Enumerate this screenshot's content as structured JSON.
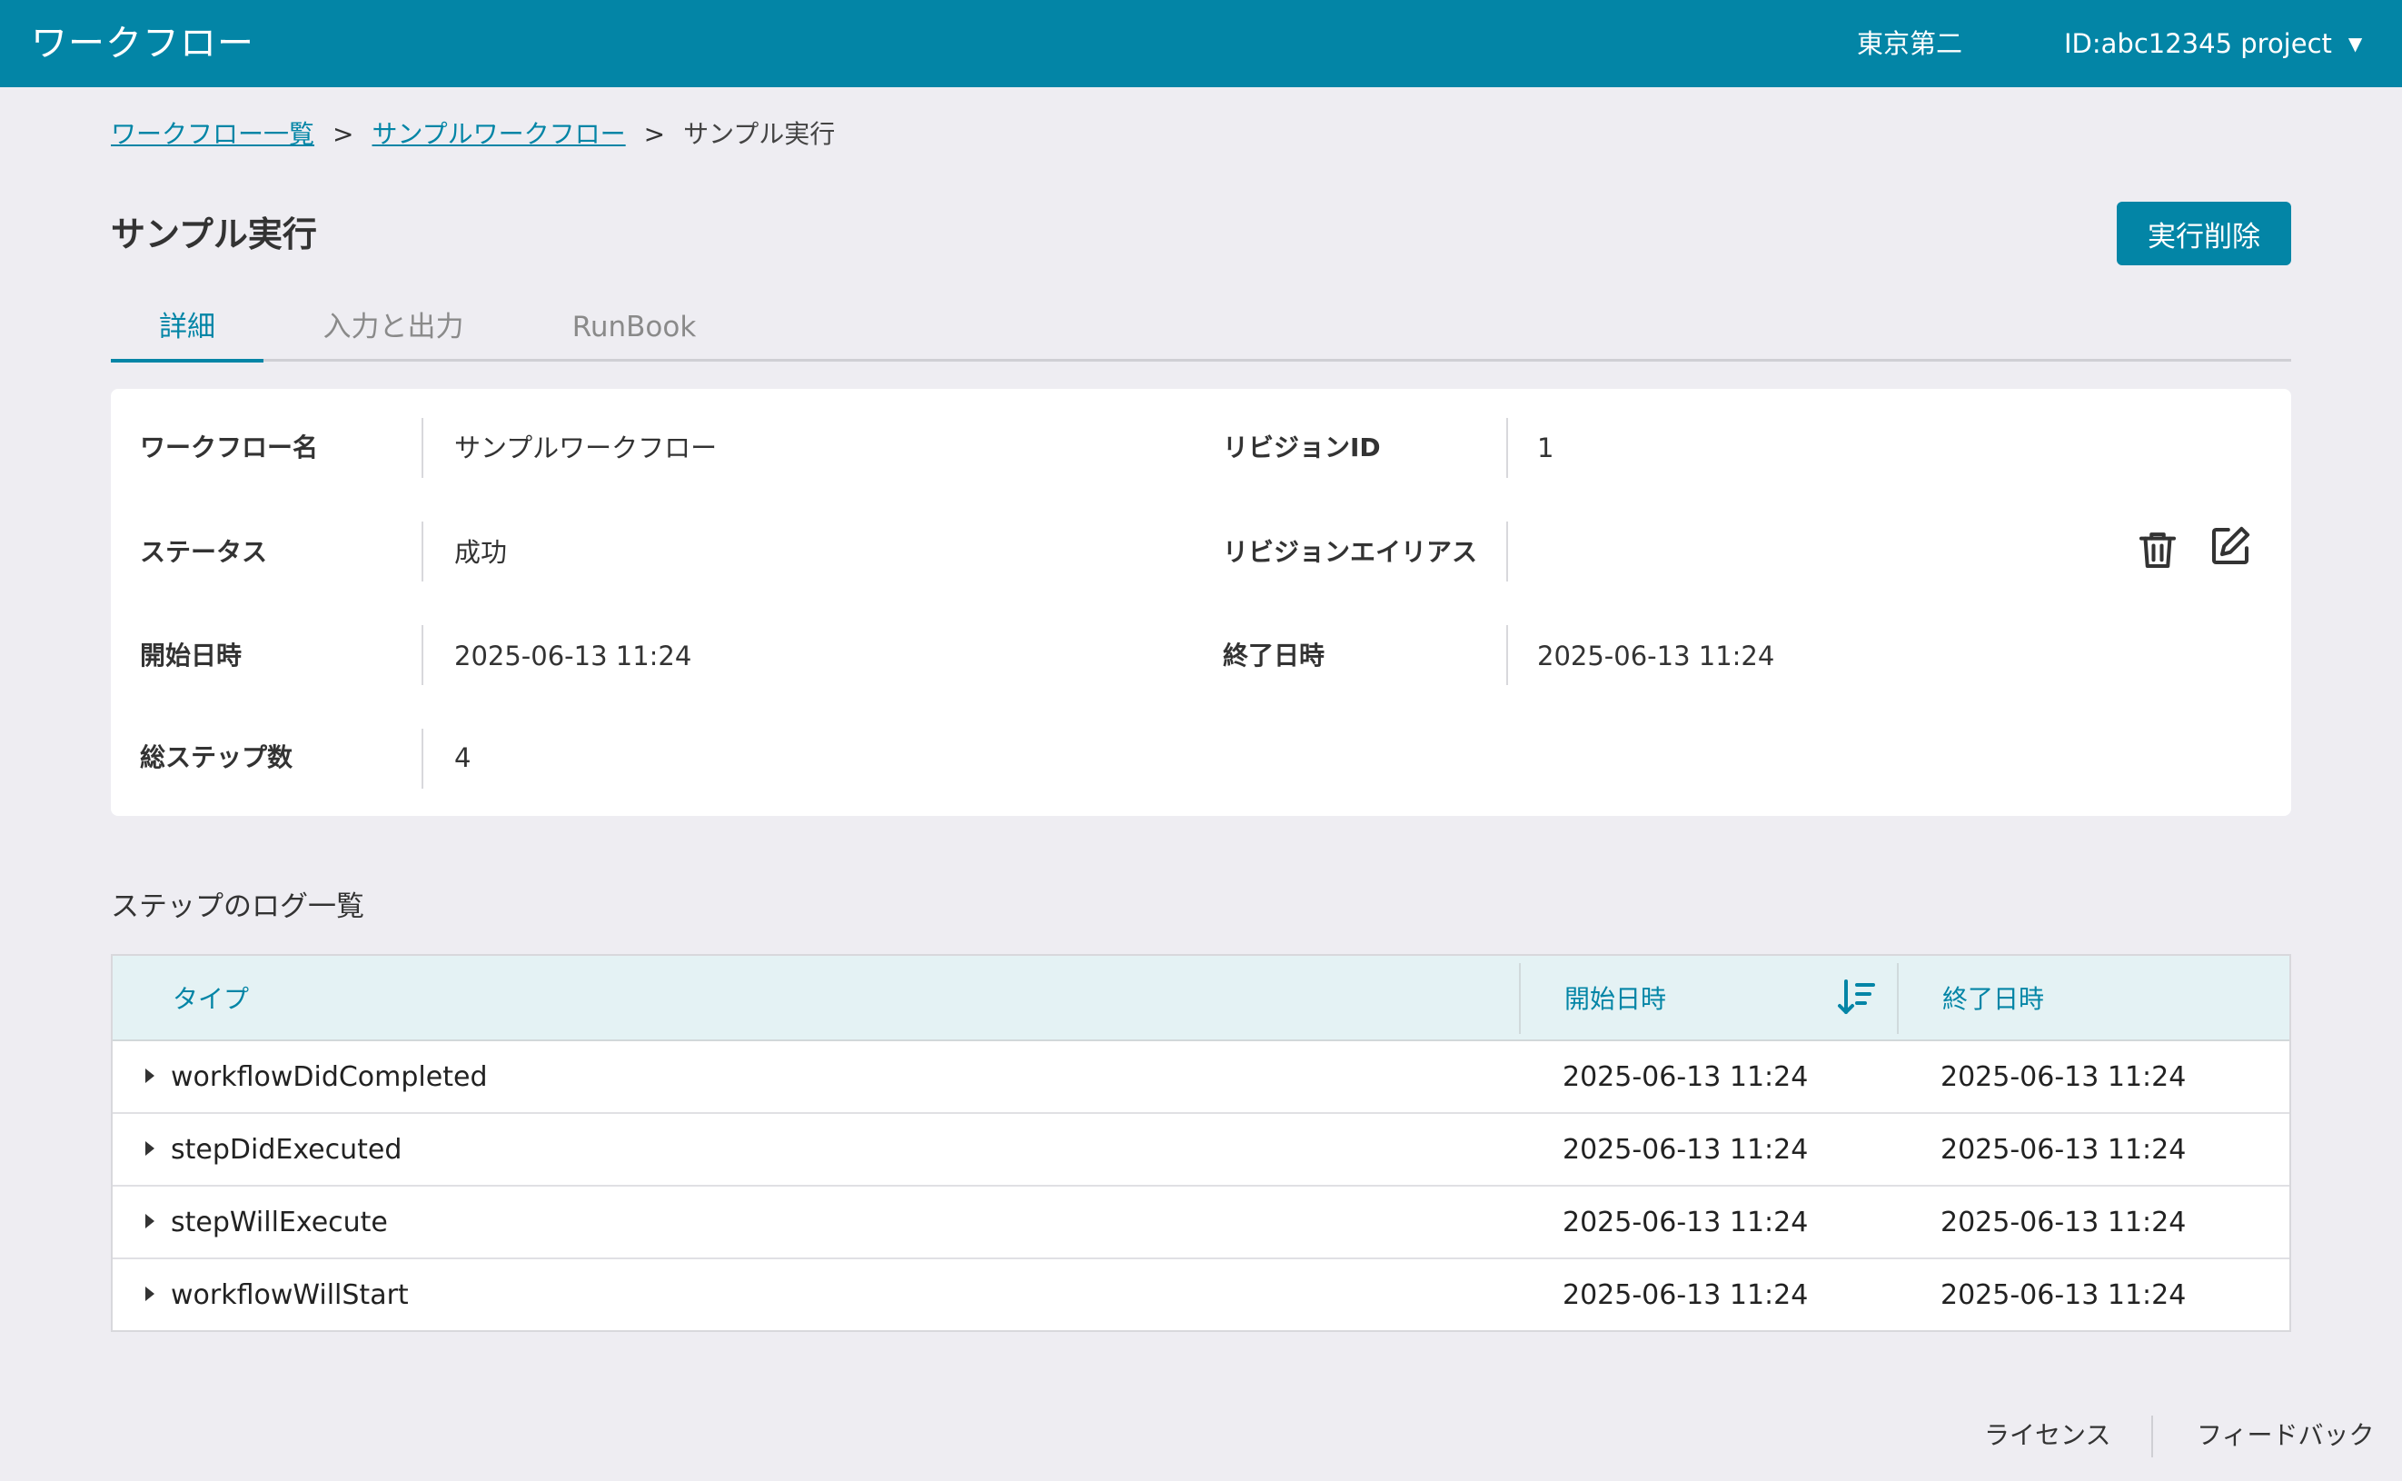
{
  "header": {
    "app_title": "ワークフロー",
    "region": "東京第二",
    "project": "ID:abc12345 project"
  },
  "breadcrumb": {
    "items": [
      "ワークフロー一覧",
      "サンプルワークフロー"
    ],
    "separator": ">",
    "current": "サンプル実行"
  },
  "page": {
    "title": "サンプル実行",
    "delete_button": "実行削除"
  },
  "tabs": [
    {
      "label": "詳細",
      "active": true
    },
    {
      "label": "入力と出力",
      "active": false
    },
    {
      "label": "RunBook",
      "active": false
    }
  ],
  "details": {
    "workflow_name_label": "ワークフロー名",
    "workflow_name": "サンプルワークフロー",
    "revision_id_label": "リビジョンID",
    "revision_id": "1",
    "status_label": "ステータス",
    "status": "成功",
    "revision_alias_label": "リビジョンエイリアス",
    "revision_alias": "",
    "start_label": "開始日時",
    "start": "2025-06-13 11:24",
    "end_label": "終了日時",
    "end": "2025-06-13 11:24",
    "total_steps_label": "総ステップ数",
    "total_steps": "4",
    "icons": [
      "trash-icon",
      "edit-icon"
    ]
  },
  "step_logs": {
    "title": "ステップのログ一覧",
    "columns": [
      "タイプ",
      "開始日時",
      "終了日時"
    ],
    "sort_column": "開始日時",
    "rows": [
      {
        "type": "workflowDidCompleted",
        "start": "2025-06-13 11:24",
        "end": "2025-06-13 11:24"
      },
      {
        "type": "stepDidExecuted",
        "start": "2025-06-13 11:24",
        "end": "2025-06-13 11:24"
      },
      {
        "type": "stepWillExecute",
        "start": "2025-06-13 11:24",
        "end": "2025-06-13 11:24"
      },
      {
        "type": "workflowWillStart",
        "start": "2025-06-13 11:24",
        "end": "2025-06-13 11:24"
      }
    ]
  },
  "footer": {
    "license": "ライセンス",
    "feedback": "フィードバック"
  },
  "colors": {
    "accent": "#0385a6",
    "background": "#eeedf2",
    "table_header": "#e4f2f4"
  }
}
